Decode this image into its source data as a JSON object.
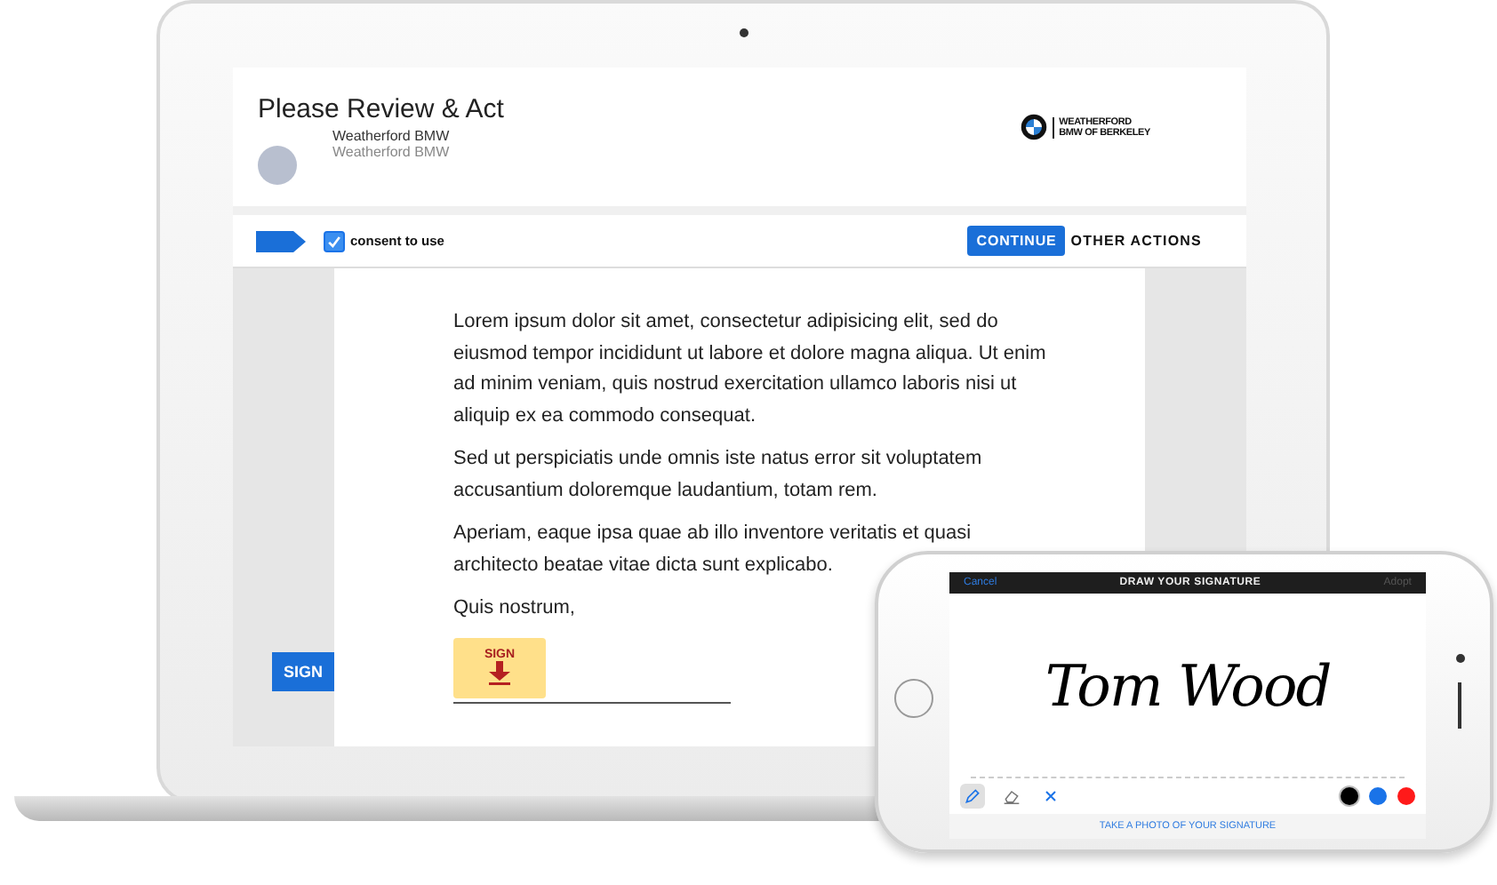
{
  "laptop": {
    "header": {
      "title": "Please Review & Act",
      "sender_name": "Weatherford BMW",
      "sender_subtitle": "Weatherford BMW",
      "logo_lines": [
        "WEATHERFORD",
        "BMW OF BERKELEY"
      ]
    },
    "toolbar": {
      "consent": {
        "label": "consent to use",
        "checked": true
      },
      "continue_button": "CONTINUE",
      "other_actions": "OTHER ACTIONS"
    },
    "document": {
      "paragraphs": [
        "Lorem ipsum dolor sit amet, consectetur adipisicing elit, sed do eiusmod tempor incididunt ut labore et dolore magna aliqua. Ut enim ad minim veniam, quis nostrud exercitation ullamco laboris nisi ut aliquip ex ea commodo consequat.",
        "Sed ut perspiciatis unde omnis iste natus error sit voluptatem accusantium doloremque laudantium, totam rem.",
        "Aperiam, eaque ipsa quae ab illo inventore veritatis et quasi architecto beatae vitae dicta sunt explicabo.",
        "Quis nostrum,"
      ],
      "sign_tab": "SIGN",
      "sign_field": "SIGN"
    }
  },
  "phone": {
    "top_bar": {
      "cancel": {
        "label": "Cancel",
        "disabled": false
      },
      "title": "DRAW YOUR SIGNATURE",
      "adopt": {
        "label": "Adopt",
        "disabled": true
      }
    },
    "signature": "Tom Wood",
    "tools": [
      {
        "kind": "pen",
        "selected": true
      },
      {
        "kind": "eraser",
        "selected": false
      },
      {
        "kind": "clear",
        "selected": false
      }
    ],
    "colors": [
      {
        "color": "#000000",
        "selected": true
      },
      {
        "color": "#1a73e8",
        "selected": false
      },
      {
        "color": "#ff1a1a",
        "selected": false
      }
    ],
    "photo_link": "TAKE A PHOTO OF YOUR SIGNATURE"
  }
}
